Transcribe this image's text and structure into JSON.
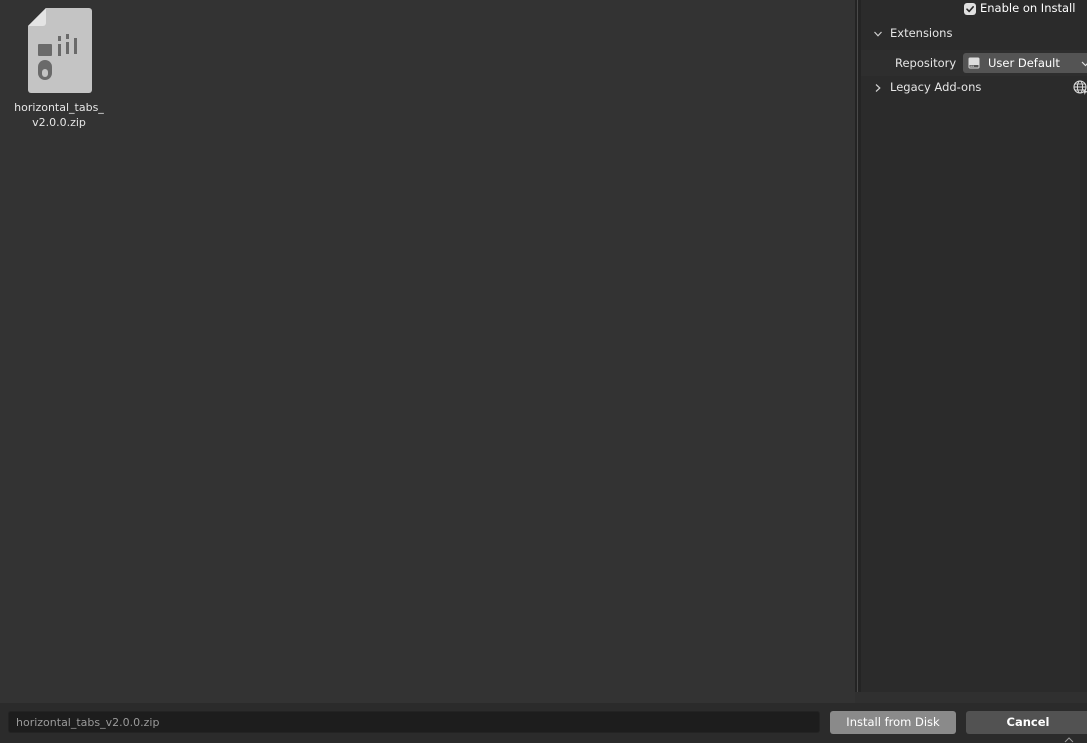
{
  "file_browser": {
    "files": [
      {
        "name": "horizontal_tabs_ v2.0.0.zip",
        "icon": "zip-file-icon"
      }
    ]
  },
  "sidebar": {
    "enable_on_install": {
      "label": "Enable on Install",
      "checked": true
    },
    "extensions_panel": {
      "title": "Extensions",
      "expanded": true,
      "repository_label": "Repository",
      "repository_value": "User Default"
    },
    "legacy_panel": {
      "title": "Legacy Add-ons",
      "expanded": false
    }
  },
  "bottom_bar": {
    "filename": "horizontal_tabs_v2.0.0.zip",
    "install_label": "Install from Disk",
    "cancel_label": "Cancel"
  },
  "colors": {
    "background": "#333333",
    "sidebar": "#2b2b2b",
    "install_button": "#8a8a8a",
    "cancel_button": "#525252"
  }
}
